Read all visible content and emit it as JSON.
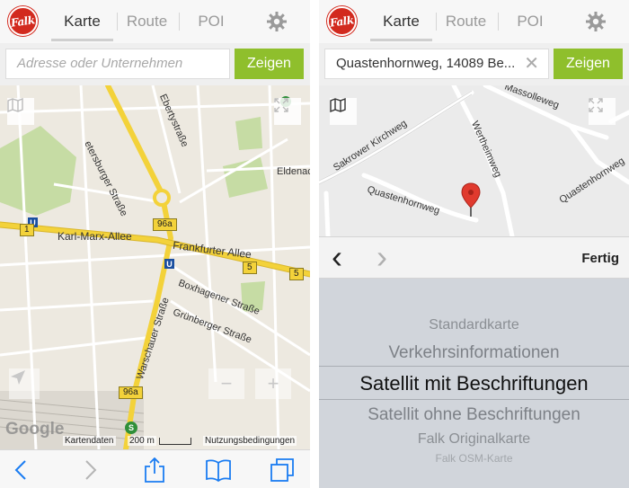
{
  "left_screen": {
    "logo_text": "Falk",
    "tabs": [
      {
        "label": "Karte",
        "active": true
      },
      {
        "label": "Route",
        "active": false
      },
      {
        "label": "POI",
        "active": false
      }
    ],
    "search": {
      "value": "",
      "placeholder": "Adresse oder Unternehmen"
    },
    "search_button": "Zeigen",
    "map": {
      "streets": [
        "etersburger Straße",
        "Ebertystraße",
        "Eldenac",
        "Karl-Marx-Allee",
        "Frankfurter Allee",
        "Boxhagener Straße",
        "Grünberger Straße",
        "Warschauer Straße"
      ],
      "route_shields": [
        "1",
        "96a",
        "5",
        "5",
        "96a"
      ],
      "transit_markers": [
        "U",
        "U",
        "S"
      ],
      "zoom_in": "+",
      "zoom_out": "−",
      "watermark": "Google",
      "attribution": {
        "data": "Kartendaten",
        "scale": "200 m",
        "terms": "Nutzungsbedingungen"
      }
    },
    "toolbar_icons": [
      "back-arrow-icon",
      "forward-arrow-icon",
      "share-icon",
      "bookmarks-icon",
      "tabs-icon"
    ]
  },
  "right_screen": {
    "logo_text": "Falk",
    "tabs": [
      {
        "label": "Karte",
        "active": true
      },
      {
        "label": "Route",
        "active": false
      },
      {
        "label": "POI",
        "active": false
      }
    ],
    "search": {
      "value": "Quastenhornweg, 14089 Be...",
      "placeholder": ""
    },
    "search_button": "Zeigen",
    "map": {
      "streets": [
        "Massolleweg",
        "Sakrower Kirchweg",
        "Wertheimweg",
        "Quastenhornweg",
        "Quastenhornweg"
      ]
    },
    "nav": {
      "back": "‹",
      "forward": "›",
      "done": "Fertig"
    },
    "picker": {
      "options": [
        "Standardkarte",
        "Verkehrsinformationen",
        "Satellit mit Beschriftungen",
        "Satellit ohne Beschriftungen",
        "Falk Originalkarte",
        "Falk OSM-Karte"
      ],
      "selected": "Satellit mit Beschriftungen"
    }
  },
  "colors": {
    "brand_red": "#d22a1e",
    "accent_green": "#8fbf2c",
    "map_bg": "#ede9e0",
    "road_yellow": "#f3d23a",
    "park_green": "#c6dca4",
    "pin_red": "#e03a2e"
  }
}
